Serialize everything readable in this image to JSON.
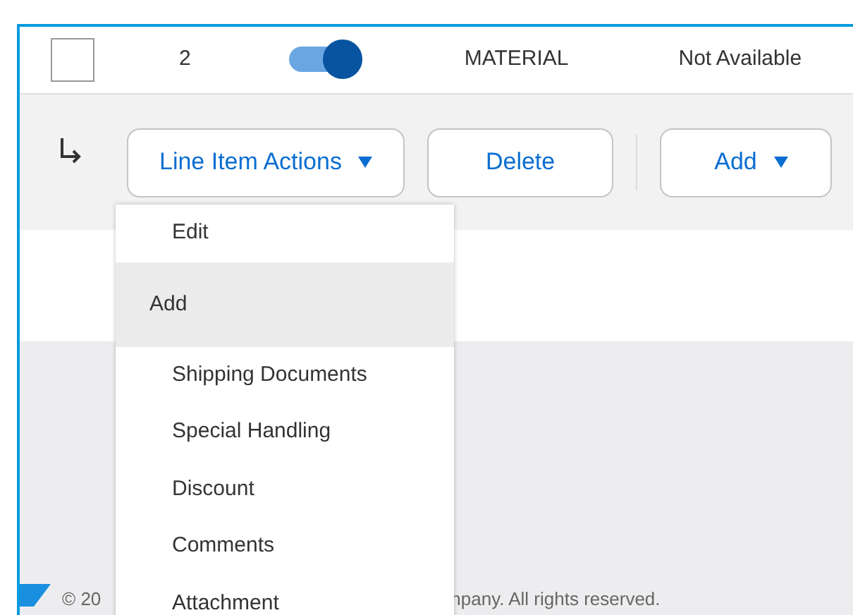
{
  "row": {
    "checked": false,
    "number": "2",
    "toggle_on": true,
    "type": "MATERIAL",
    "availability": "Not Available"
  },
  "actions": {
    "buttons": [
      {
        "label": "Line Item Actions",
        "dropdown": true
      },
      {
        "label": "Delete",
        "dropdown": false
      },
      {
        "label": "Add",
        "dropdown": true
      }
    ]
  },
  "menu": {
    "items": [
      {
        "label": "Edit",
        "kind": "item"
      },
      {
        "label": "Add",
        "kind": "header"
      },
      {
        "label": "Shipping Documents",
        "kind": "item"
      },
      {
        "label": "Special Handling",
        "kind": "item"
      },
      {
        "label": "Discount",
        "kind": "item"
      },
      {
        "label": "Comments",
        "kind": "item"
      },
      {
        "label": "Attachment",
        "kind": "item"
      }
    ]
  },
  "footer": {
    "text_start": "© 20",
    "text_end": "npany. All rights reserved."
  }
}
